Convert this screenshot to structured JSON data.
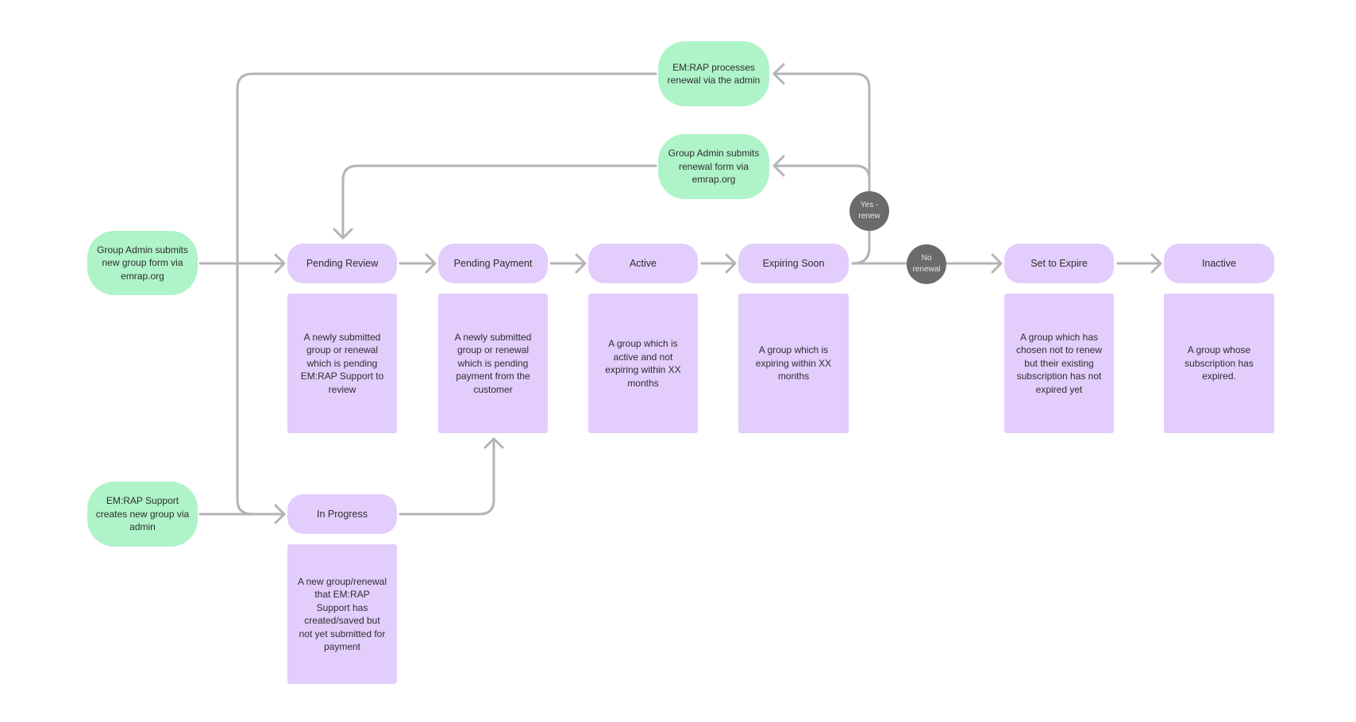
{
  "colors": {
    "start_node": "#aff3c9",
    "state_node": "#e3cdfc",
    "connector": "#b3b3b3",
    "decision": "#6b6b6b"
  },
  "start_nodes": {
    "new_group_form": "Group Admin submits new group form via emrap.org",
    "support_creates": "EM:RAP Support creates new group via admin",
    "processes_renewal": "EM:RAP processes renewal via the admin",
    "renewal_form": "Group Admin submits renewal form via emrap.org"
  },
  "states": [
    {
      "label": "Pending Review",
      "description": "A newly submitted group or renewal which is pending EM:RAP Support to review"
    },
    {
      "label": "Pending Payment",
      "description": "A newly submitted group or renewal which is pending payment from the customer"
    },
    {
      "label": "Active",
      "description": "A group which is active and not expiring within XX months"
    },
    {
      "label": "Expiring Soon",
      "description": "A group which is expiring within XX months"
    },
    {
      "label": "Set to Expire",
      "description": "A group which has chosen not to renew but their existing subscription has not expired yet"
    },
    {
      "label": "Inactive",
      "description": "A group whose subscription has expired."
    },
    {
      "label": "In Progress",
      "description": "A new group/renewal that EM:RAP Support has created/saved but not yet submitted for payment"
    }
  ],
  "decisions": {
    "yes_renew": "Yes - renew",
    "no_renewal": "No renewal"
  }
}
